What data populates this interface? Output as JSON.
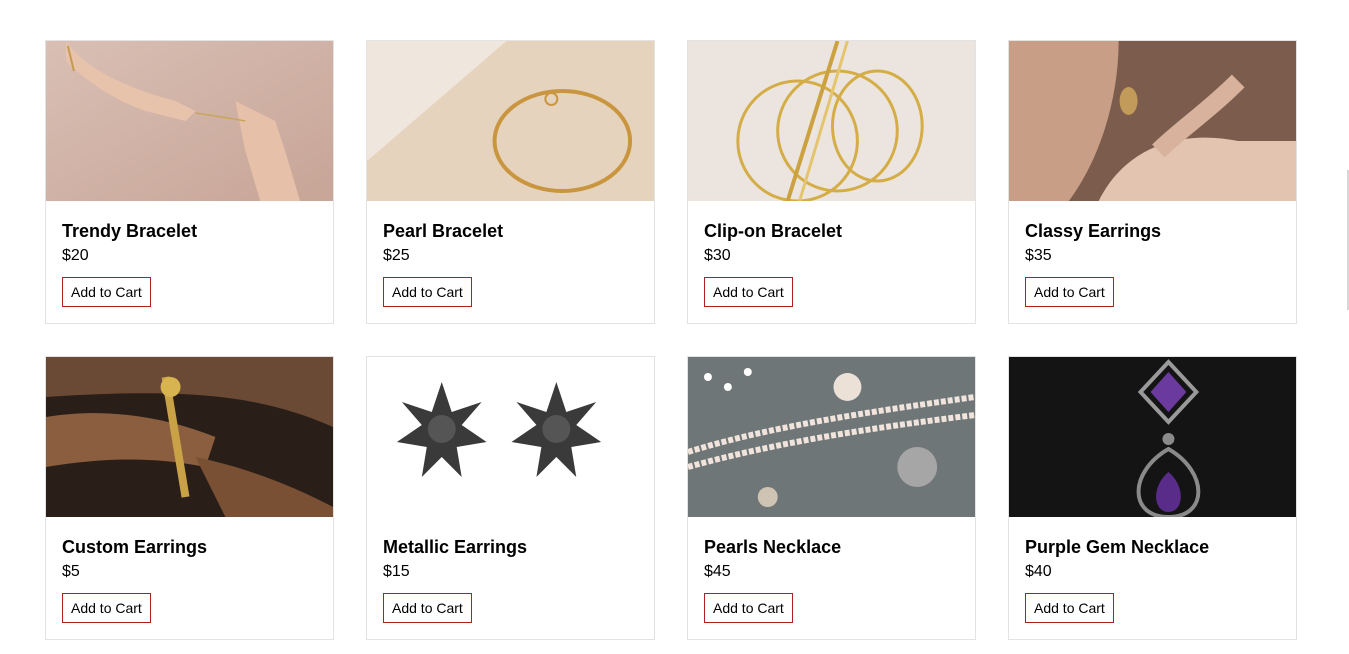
{
  "products": [
    {
      "title": "Trendy Bracelet",
      "price": "$20",
      "button": "Add to Cart",
      "image": "hand-bracelet-photo"
    },
    {
      "title": "Pearl Bracelet",
      "price": "$25",
      "button": "Add to Cart",
      "image": "gold-chain-bracelet-photo"
    },
    {
      "title": "Clip-on Bracelet",
      "price": "$30",
      "button": "Add to Cart",
      "image": "gold-cuff-bracelets-photo"
    },
    {
      "title": "Classy Earrings",
      "price": "$35",
      "button": "Add to Cart",
      "image": "gold-earring-model-photo"
    },
    {
      "title": "Custom Earrings",
      "price": "$5",
      "button": "Add to Cart",
      "image": "jeweler-hands-photo"
    },
    {
      "title": "Metallic Earrings",
      "price": "$15",
      "button": "Add to Cart",
      "image": "star-earrings-photo"
    },
    {
      "title": "Pearls Necklace",
      "price": "$45",
      "button": "Add to Cart",
      "image": "pearl-jewelry-photo"
    },
    {
      "title": "Purple Gem Necklace",
      "price": "$40",
      "button": "Add to Cart",
      "image": "purple-gem-pendant-photo"
    }
  ],
  "colors": {
    "button_border": "#b02020",
    "card_border": "#e3e3e3"
  }
}
